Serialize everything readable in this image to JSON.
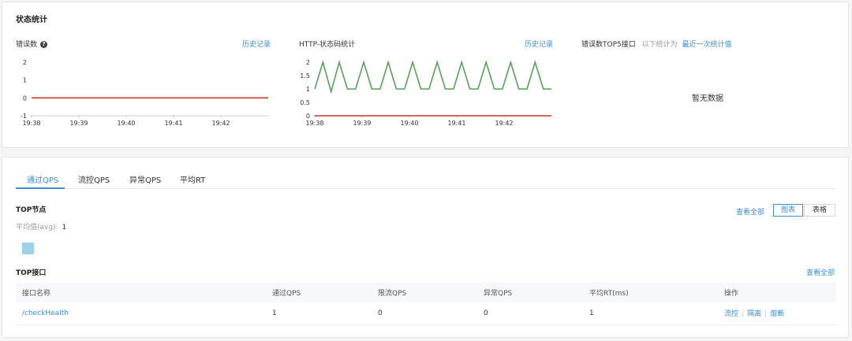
{
  "status_panel": {
    "title": "状态统计",
    "errors": {
      "label": "错误数",
      "history_link": "历史记录"
    },
    "http": {
      "label": "HTTP-状态码统计",
      "history_link": "历史记录"
    },
    "top5": {
      "label": "错误数TOP5接口",
      "hint": "以下统计为",
      "link": "最近一次统计值",
      "empty": "暂无数据"
    }
  },
  "chart_data": [
    {
      "type": "line",
      "x_ticks": [
        "19:38",
        "19:39",
        "19:40",
        "19:41",
        "19:42"
      ],
      "y_ticks": [
        "2",
        "1",
        "0",
        "-1"
      ],
      "ylim": [
        -1,
        2
      ],
      "series": [
        {
          "color": "#c0392b",
          "values": [
            0,
            0,
            0,
            0,
            0,
            0
          ]
        }
      ]
    },
    {
      "type": "line",
      "x_ticks": [
        "19:38",
        "19:39",
        "19:40",
        "19:41",
        "19:42"
      ],
      "y_ticks": [
        "2",
        "1.5",
        "1",
        "0.5",
        "0"
      ],
      "ylim": [
        0,
        2
      ],
      "series": [
        {
          "color": "#5a9e5a",
          "values": [
            1,
            2,
            0.9,
            2,
            1,
            1,
            2,
            1,
            1,
            2,
            1,
            1,
            2,
            1,
            1,
            2,
            1,
            1,
            2,
            1,
            1,
            2,
            1,
            1,
            2,
            1,
            1,
            2,
            1,
            1
          ]
        },
        {
          "color": "#c0392b",
          "values": [
            0,
            0,
            0,
            0,
            0,
            0
          ]
        }
      ]
    }
  ],
  "qps_panel": {
    "tabs": [
      "通过QPS",
      "流控QPS",
      "异常QPS",
      "平均RT"
    ],
    "active_tab": 0,
    "top_nodes": {
      "title": "TOP节点",
      "avg_label": "平均值(avg):",
      "avg_value": "1",
      "view_all": "查看全部"
    },
    "toggle": {
      "chart": "图表",
      "table": "表格"
    },
    "top_api": {
      "title": "TOP接口",
      "view_all": "查看全部",
      "columns": [
        "接口名称",
        "通过QPS",
        "限流QPS",
        "异常QPS",
        "平均RT(ms)",
        "操作"
      ],
      "rows": [
        {
          "name": "/checkHealth",
          "pass": "1",
          "limit": "0",
          "error": "0",
          "rt": "1",
          "actions": [
            "流控",
            "隔离",
            "熔断"
          ]
        }
      ]
    }
  }
}
